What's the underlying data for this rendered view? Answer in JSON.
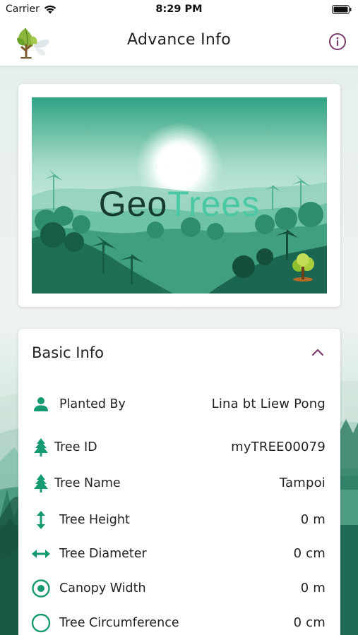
{
  "status_bar": {
    "carrier": "Carrier",
    "time": "8:29 PM"
  },
  "nav": {
    "title": "Advance Info",
    "logo_icon": "tree-leaf-logo",
    "info_icon": "info-circle-icon"
  },
  "hero": {
    "brand_prefix": "Geo",
    "brand_suffix": "Trees"
  },
  "basic_info": {
    "title": "Basic Info",
    "rows": [
      {
        "icon": "person-icon",
        "label": "Planted By",
        "value": "Lina bt Liew Pong"
      },
      {
        "icon": "tree-icon",
        "label": "Tree ID",
        "value": "myTREE00079"
      },
      {
        "icon": "tree-icon",
        "label": "Tree Name",
        "value": "Tampoi"
      },
      {
        "icon": "vertical-arrows-icon",
        "label": "Tree Height",
        "value": "0 m"
      },
      {
        "icon": "horizontal-arrows-icon",
        "label": "Tree Diameter",
        "value": "0 cm"
      },
      {
        "icon": "radio-dot-icon",
        "label": "Canopy Width",
        "value": "0 m"
      },
      {
        "icon": "circle-outline-icon",
        "label": "Tree Circumference",
        "value": "0 cm"
      }
    ]
  },
  "colors": {
    "accent_green": "#169a71",
    "info_purple": "#7a3b6b",
    "brand_dark": "#163c2e",
    "brand_light": "#49c8a3"
  }
}
